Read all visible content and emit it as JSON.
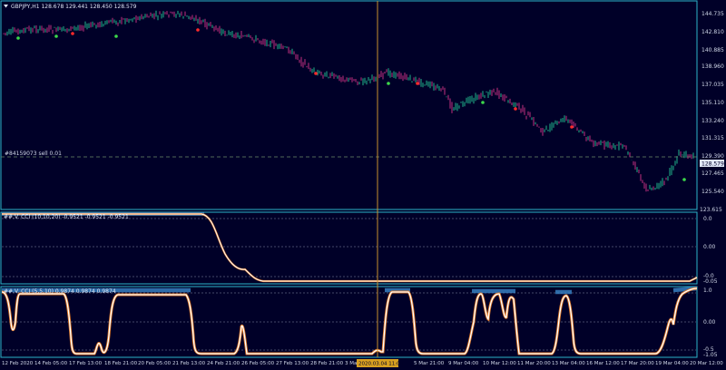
{
  "window": {
    "menu_icon": "triangle-down-icon",
    "symbol_line": "GBPJPY,H1  128.678 129.441 128.450 128.579"
  },
  "order_line_label": "#84159073 sell 0.01",
  "current_price_tag": "128.579",
  "crosshair_time": "2020.03.04 11:00",
  "price_axis": {
    "ticks": [
      "144.735",
      "142.810",
      "140.885",
      "138.960",
      "137.035",
      "135.110",
      "133.240",
      "131.315",
      "129.390",
      "127.465",
      "125.540"
    ],
    "mid_label": "129.390"
  },
  "indicator1": {
    "header": "##.V. CCI (10,10,20) -0.9521 -0.9521 -0.9521",
    "top_level": "123.615",
    "levels": [
      "0.0",
      "0.00",
      "-0.0",
      "-0.05"
    ]
  },
  "indicator2": {
    "header": "##.V. CCI (5,5,10) 0.9874 0.9874 0.9874",
    "levels": [
      "1.0",
      "0.00",
      "-0.5",
      "-1.05"
    ]
  },
  "time_axis": [
    "12 Feb 2020",
    "14 Feb 05:00",
    "17 Feb 13:00",
    "18 Feb 21:00",
    "20 Feb 05:00",
    "21 Feb 13:00",
    "24 Feb 21:00",
    "26 Feb 05:00",
    "27 Feb 13:00",
    "28 Feb 21:00",
    "3 Mar 05:00",
    "",
    "5 Mar 21:00",
    "9 Mar 04:00",
    "10 Mar 12:00",
    "11 Mar 20:00",
    "13 Mar 04:00",
    "16 Mar 12:00",
    "17 Mar 20:00",
    "19 Mar 04:00",
    "20 Mar 12:00"
  ],
  "colors": {
    "background": "#000028",
    "bull": "#1fb58a",
    "bear": "#c2307f",
    "marker_green": "#3cd84a",
    "marker_red": "#ff2a2a",
    "crosshair": "#c8902e",
    "panel_border": "#2bb3c9",
    "osc_line": "#ffffff",
    "osc_glow": "#3a86c8",
    "osc_orange": "#e07a2a",
    "time_tag_bg": "#d8a020"
  }
}
